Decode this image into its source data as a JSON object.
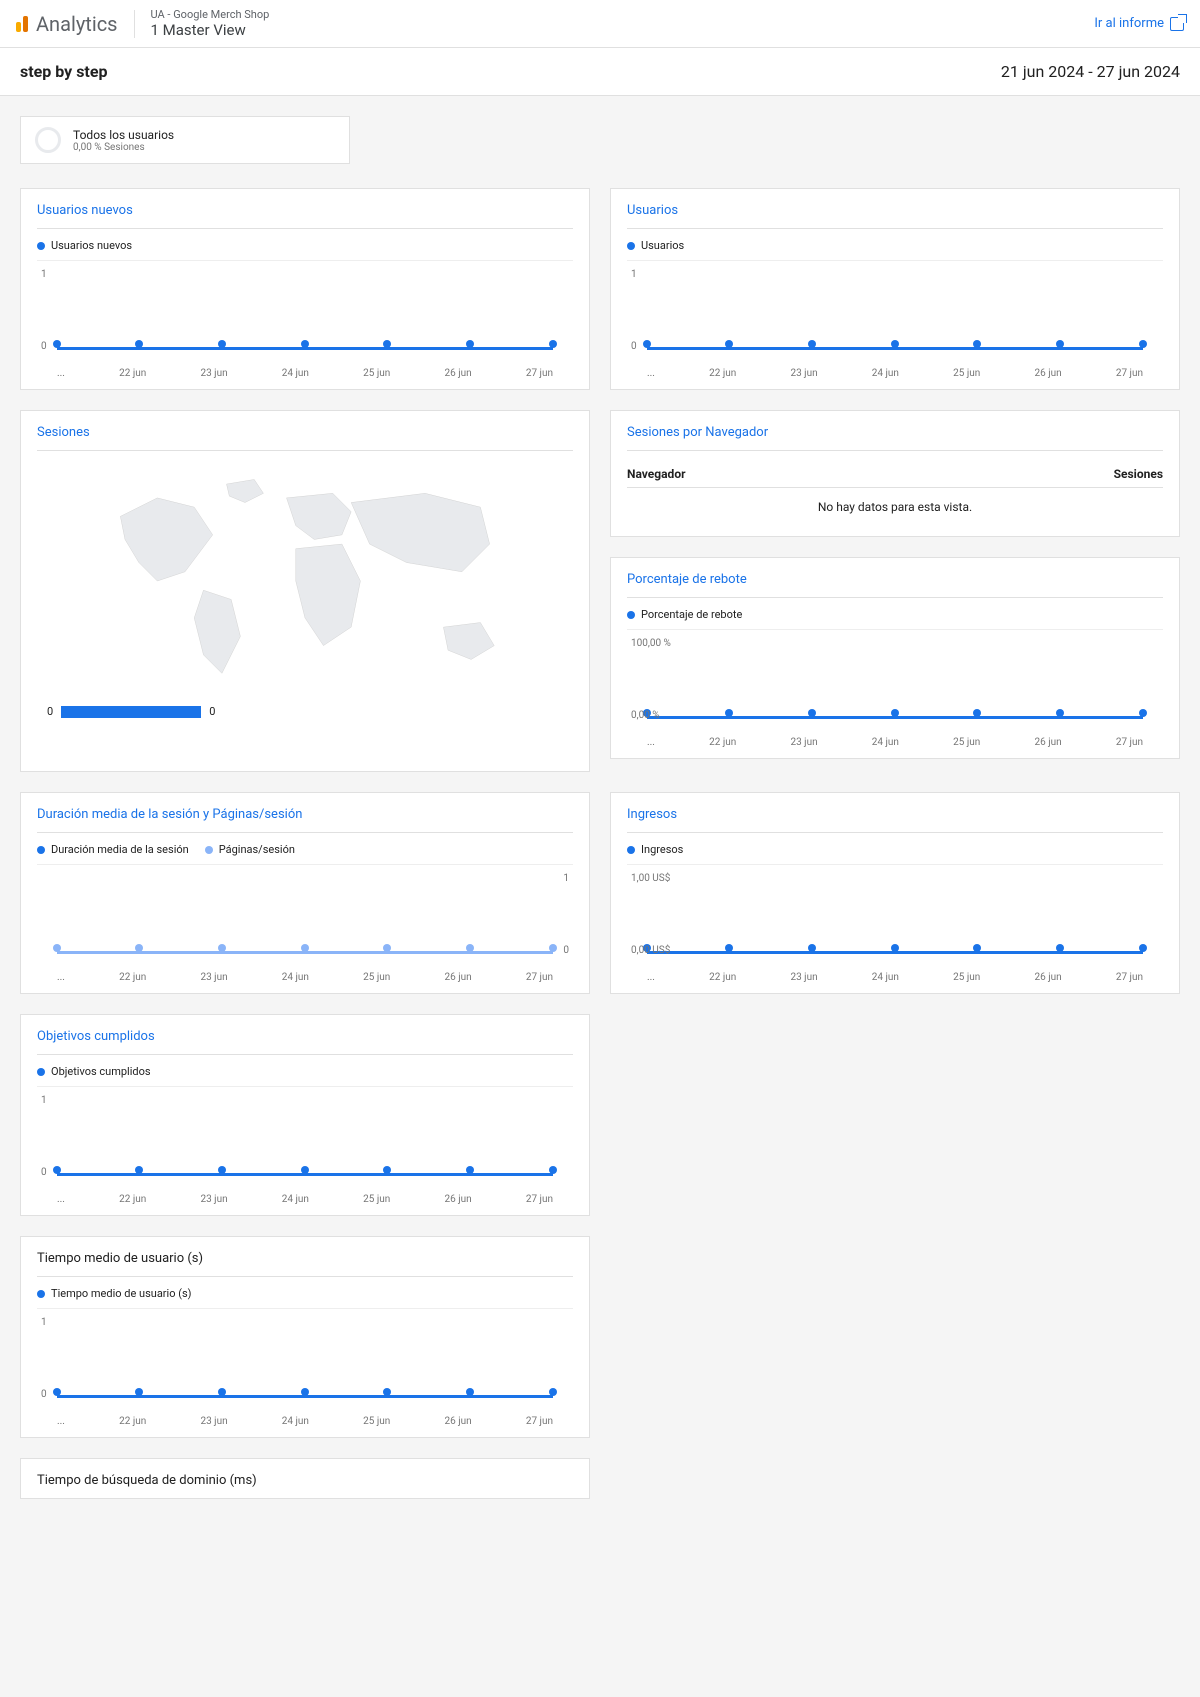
{
  "header": {
    "analytics_label": "Analytics",
    "property_label": "UA - Google Merch Shop",
    "view_name": "1 Master View",
    "report_link": "Ir al informe"
  },
  "title_bar": {
    "dashboard_title": "step by step",
    "date_range": "21 jun 2024 - 27 jun 2024"
  },
  "segment": {
    "title": "Todos los usuarios",
    "subtitle": "0,00 % Sesiones"
  },
  "x_categories": [
    "...",
    "22 jun",
    "23 jun",
    "24 jun",
    "25 jun",
    "26 jun",
    "27 jun"
  ],
  "cards": {
    "new_users": {
      "title": "Usuarios nuevos",
      "legend": "Usuarios nuevos",
      "y_top": "1",
      "y_bottom": "0"
    },
    "users": {
      "title": "Usuarios",
      "legend": "Usuarios",
      "y_top": "1",
      "y_bottom": "0"
    },
    "sessions": {
      "title": "Sesiones",
      "legend_min": "0",
      "legend_max": "0"
    },
    "sessions_browser": {
      "title": "Sesiones por Navegador",
      "col_browser": "Navegador",
      "col_sessions": "Sesiones",
      "no_data": "No hay datos para esta vista."
    },
    "bounce": {
      "title": "Porcentaje de rebote",
      "legend": "Porcentaje de rebote",
      "y_top": "100,00 %",
      "y_bottom": "0,00 %"
    },
    "duration": {
      "title": "Duración media de la sesión y Páginas/sesión",
      "legend1": "Duración media de la sesión",
      "legend2": "Páginas/sesión",
      "y_top": "1",
      "y_bottom": "0"
    },
    "revenue": {
      "title": "Ingresos",
      "legend": "Ingresos",
      "y_top": "1,00 US$",
      "y_bottom": "0,00 US$"
    },
    "goals": {
      "title": "Objetivos cumplidos",
      "legend": "Objetivos cumplidos",
      "y_top": "1",
      "y_bottom": "0"
    },
    "avg_user_time": {
      "title": "Tiempo medio de usuario (s)",
      "legend": "Tiempo medio de usuario (s)",
      "y_top": "1",
      "y_bottom": "0"
    },
    "dns_time": {
      "title": "Tiempo de búsqueda de dominio (ms)"
    }
  },
  "chart_data": [
    {
      "type": "line",
      "title": "Usuarios nuevos",
      "x": [
        "21 jun",
        "22 jun",
        "23 jun",
        "24 jun",
        "25 jun",
        "26 jun",
        "27 jun"
      ],
      "series": [
        {
          "name": "Usuarios nuevos",
          "values": [
            0,
            0,
            0,
            0,
            0,
            0,
            0
          ]
        }
      ],
      "ylim": [
        0,
        1
      ]
    },
    {
      "type": "line",
      "title": "Usuarios",
      "x": [
        "21 jun",
        "22 jun",
        "23 jun",
        "24 jun",
        "25 jun",
        "26 jun",
        "27 jun"
      ],
      "series": [
        {
          "name": "Usuarios",
          "values": [
            0,
            0,
            0,
            0,
            0,
            0,
            0
          ]
        }
      ],
      "ylim": [
        0,
        1
      ]
    },
    {
      "type": "map",
      "title": "Sesiones",
      "legend_range": [
        0,
        0
      ]
    },
    {
      "type": "table",
      "title": "Sesiones por Navegador",
      "columns": [
        "Navegador",
        "Sesiones"
      ],
      "rows": []
    },
    {
      "type": "line",
      "title": "Porcentaje de rebote",
      "x": [
        "21 jun",
        "22 jun",
        "23 jun",
        "24 jun",
        "25 jun",
        "26 jun",
        "27 jun"
      ],
      "series": [
        {
          "name": "Porcentaje de rebote",
          "values": [
            0,
            0,
            0,
            0,
            0,
            0,
            0
          ]
        }
      ],
      "ylim": [
        0,
        100
      ],
      "y_unit": "%"
    },
    {
      "type": "line",
      "title": "Duración media de la sesión y Páginas/sesión",
      "x": [
        "21 jun",
        "22 jun",
        "23 jun",
        "24 jun",
        "25 jun",
        "26 jun",
        "27 jun"
      ],
      "series": [
        {
          "name": "Duración media de la sesión",
          "values": [
            0,
            0,
            0,
            0,
            0,
            0,
            0
          ]
        },
        {
          "name": "Páginas/sesión",
          "values": [
            0,
            0,
            0,
            0,
            0,
            0,
            0
          ]
        }
      ],
      "ylim": [
        0,
        1
      ]
    },
    {
      "type": "line",
      "title": "Ingresos",
      "x": [
        "21 jun",
        "22 jun",
        "23 jun",
        "24 jun",
        "25 jun",
        "26 jun",
        "27 jun"
      ],
      "series": [
        {
          "name": "Ingresos",
          "values": [
            0,
            0,
            0,
            0,
            0,
            0,
            0
          ]
        }
      ],
      "ylim": [
        0,
        1
      ],
      "y_unit": "US$"
    },
    {
      "type": "line",
      "title": "Objetivos cumplidos",
      "x": [
        "21 jun",
        "22 jun",
        "23 jun",
        "24 jun",
        "25 jun",
        "26 jun",
        "27 jun"
      ],
      "series": [
        {
          "name": "Objetivos cumplidos",
          "values": [
            0,
            0,
            0,
            0,
            0,
            0,
            0
          ]
        }
      ],
      "ylim": [
        0,
        1
      ]
    },
    {
      "type": "line",
      "title": "Tiempo medio de usuario (s)",
      "x": [
        "21 jun",
        "22 jun",
        "23 jun",
        "24 jun",
        "25 jun",
        "26 jun",
        "27 jun"
      ],
      "series": [
        {
          "name": "Tiempo medio de usuario (s)",
          "values": [
            0,
            0,
            0,
            0,
            0,
            0,
            0
          ]
        }
      ],
      "ylim": [
        0,
        1
      ]
    }
  ]
}
